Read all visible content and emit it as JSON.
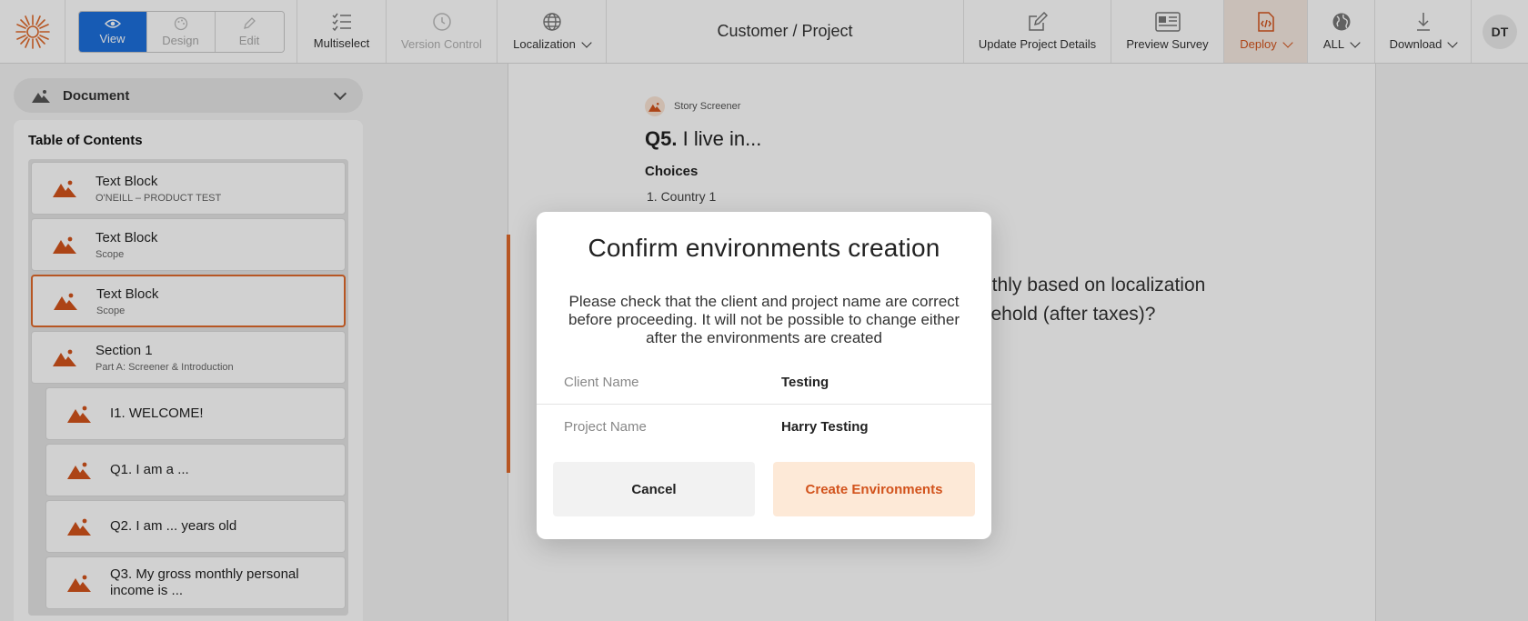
{
  "toolbar": {
    "modes": [
      {
        "label": "View",
        "icon": "eye-icon",
        "active": true
      },
      {
        "label": "Design",
        "icon": "palette-icon",
        "active": false
      },
      {
        "label": "Edit",
        "icon": "pencil-icon",
        "active": false
      }
    ],
    "multiselect_label": "Multiselect",
    "version_control_label": "Version Control",
    "localization_label": "Localization",
    "title": "Customer / Project",
    "update_details_label": "Update Project Details",
    "preview_label": "Preview Survey",
    "deploy_label": "Deploy",
    "all_label": "ALL",
    "download_label": "Download",
    "avatar_initials": "DT"
  },
  "sidebar": {
    "document_select": "Document",
    "toc_title": "Table of Contents",
    "items": [
      {
        "name": "Text Block",
        "sub": "O'NEILL – PRODUCT TEST"
      },
      {
        "name": "Text Block",
        "sub": "Scope"
      },
      {
        "name": "Text Block",
        "sub": "Scope"
      },
      {
        "name": "Section 1",
        "sub": "Part A: Screener & Introduction"
      },
      {
        "name": "I1. WELCOME!"
      },
      {
        "name": "Q1. I am a ..."
      },
      {
        "name": "Q2. I am ... years old"
      },
      {
        "name": "Q3. My gross monthly personal income is ..."
      }
    ]
  },
  "document": {
    "badge_label": "Story Screener",
    "question_number": "Q5.",
    "question_text": "I live in...",
    "choices_label": "Choices",
    "choice_1": "1.  Country 1",
    "hidden_line_1": "nthly based on localization",
    "hidden_line_2": "sehold (after taxes)?"
  },
  "modal": {
    "title": "Confirm environments creation",
    "message": "Please check that the client and project name are correct before proceeding. It will not be possible to change either after the environments are created",
    "client_label": "Client Name",
    "client_value": "Testing",
    "project_label": "Project Name",
    "project_value": "Harry Testing",
    "cancel_label": "Cancel",
    "create_label": "Create Environments"
  },
  "colors": {
    "accent_blue": "#1d6fdc",
    "accent_orange": "#e06a2b",
    "deploy_text": "#d2531c"
  }
}
